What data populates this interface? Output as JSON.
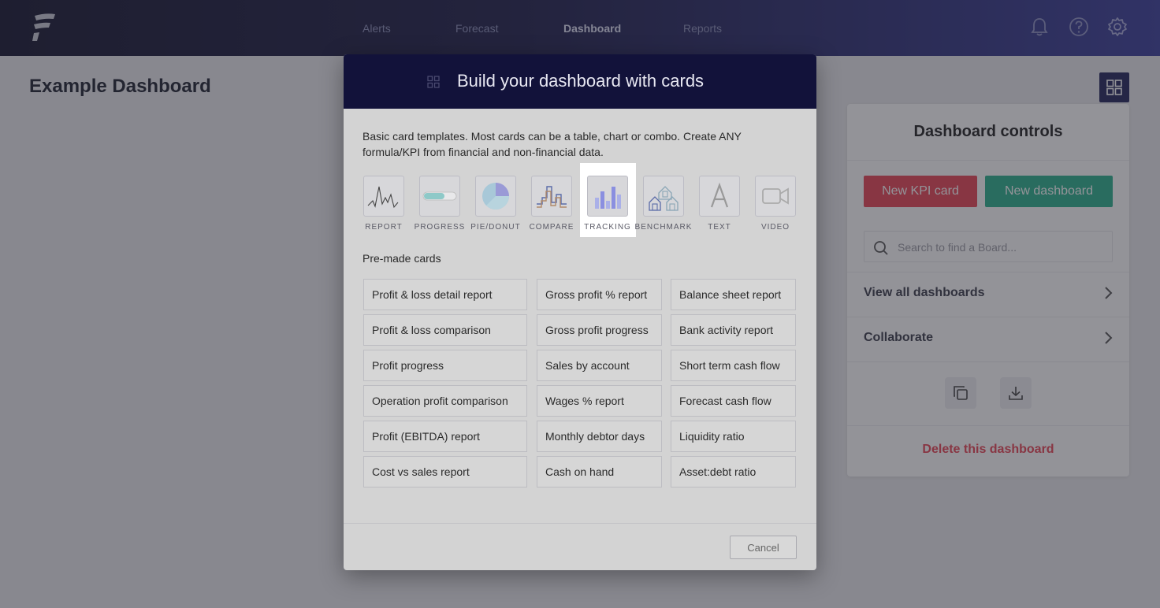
{
  "nav": {
    "items": [
      {
        "label": "Alerts"
      },
      {
        "label": "Forecast"
      },
      {
        "label": "Dashboard",
        "active": true
      },
      {
        "label": "Reports"
      }
    ]
  },
  "page": {
    "title": "Example Dashboard"
  },
  "controls": {
    "title": "Dashboard controls",
    "new_kpi_label": "New KPI card",
    "new_dashboard_label": "New dashboard",
    "search_placeholder": "Search to find a Board...",
    "view_all_label": "View all dashboards",
    "collaborate_label": "Collaborate",
    "delete_label": "Delete this dashboard"
  },
  "modal": {
    "title": "Build your dashboard with cards",
    "intro": "Basic card templates. Most cards can be a table, chart or combo. Create ANY formula/KPI from financial and non-financial data.",
    "templates": [
      {
        "label": "REPORT",
        "icon": "report-line-icon"
      },
      {
        "label": "PROGRESS",
        "icon": "progress-bar-icon"
      },
      {
        "label": "PIE/DONUT",
        "icon": "pie-chart-icon"
      },
      {
        "label": "COMPARE",
        "icon": "compare-icon"
      },
      {
        "label": "TRACKING",
        "icon": "bar-chart-icon",
        "selected": true
      },
      {
        "label": "BENCHMARK",
        "icon": "houses-icon"
      },
      {
        "label": "TEXT",
        "icon": "text-icon"
      },
      {
        "label": "VIDEO",
        "icon": "video-camera-icon"
      }
    ],
    "premade_label": "Pre-made cards",
    "cards": {
      "col1": [
        "Profit & loss detail report",
        "Profit & loss comparison",
        "Profit progress",
        "Operation profit comparison",
        "Profit (EBITDA) report",
        "Cost vs sales report"
      ],
      "col2": [
        "Gross profit % report",
        "Gross profit progress",
        "Sales by account",
        "Wages % report",
        "Monthly debtor days",
        "Cash on hand"
      ],
      "col3": [
        "Balance sheet report",
        "Bank activity report",
        "Short term cash flow",
        "Forecast cash flow",
        "Liquidity ratio",
        "Asset:debt ratio"
      ]
    },
    "cancel_label": "Cancel"
  },
  "colors": {
    "accent_red": "#e84455",
    "accent_green": "#2bb08d",
    "header_navy": "#12123a"
  }
}
